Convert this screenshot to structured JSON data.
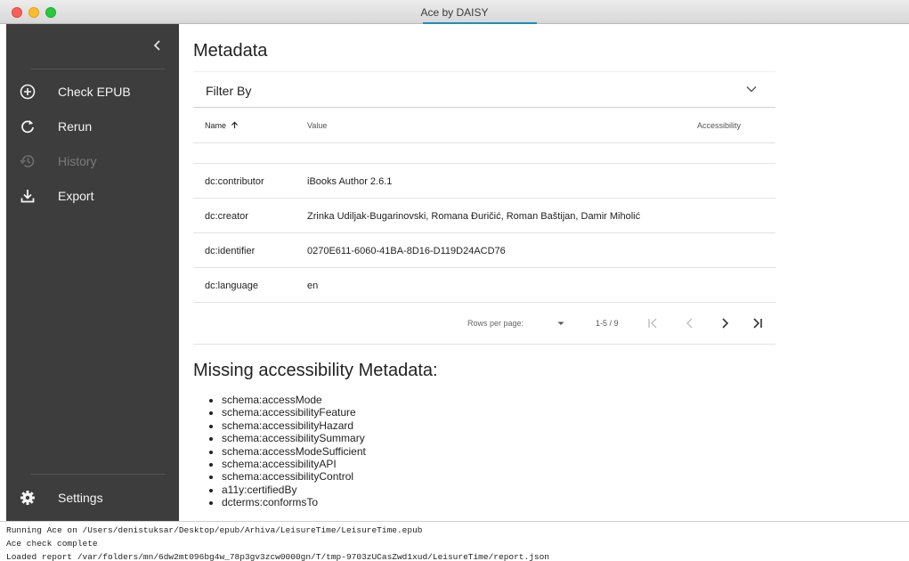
{
  "window": {
    "title": "Ace by DAISY"
  },
  "sidebar": {
    "items": [
      {
        "label": "Check EPUB",
        "icon": "add-circle-icon",
        "disabled": false
      },
      {
        "label": "Rerun",
        "icon": "refresh-icon",
        "disabled": false
      },
      {
        "label": "History",
        "icon": "history-icon",
        "disabled": true
      },
      {
        "label": "Export",
        "icon": "download-icon",
        "disabled": false
      }
    ],
    "settings_label": "Settings",
    "settings_icon": "gear-icon"
  },
  "main": {
    "title": "Metadata",
    "filter_label": "Filter By",
    "table": {
      "columns": [
        "Name",
        "Value",
        "Accessibility"
      ],
      "rows": [
        {
          "name": "",
          "value": ""
        },
        {
          "name": "dc:contributor",
          "value": "iBooks Author 2.6.1"
        },
        {
          "name": "dc:creator",
          "value": "Zrinka Udiljak-Bugarinovski, Romana Đuričić, Roman Baštijan, Damir Miholić"
        },
        {
          "name": "dc:identifier",
          "value": "0270E611-6060-41BA-8D16-D119D24ACD76"
        },
        {
          "name": "dc:language",
          "value": "en"
        }
      ]
    },
    "pagination": {
      "rows_per_page_label": "Rows per page:",
      "range": "1-5 / 9"
    },
    "missing_title": "Missing accessibility Metadata:",
    "missing_items": [
      "schema:accessMode",
      "schema:accessibilityFeature",
      "schema:accessibilityHazard",
      "schema:accessibilitySummary",
      "schema:accessModeSufficient",
      "schema:accessibilityAPI",
      "schema:accessibilityControl",
      "a11y:certifiedBy",
      "dcterms:conformsTo"
    ]
  },
  "console": {
    "lines": [
      "Running Ace on /Users/denistuksar/Desktop/epub/Arhiva/LeisureTime/LeisureTime.epub",
      "Ace check complete",
      "Loaded report /var/folders/mn/6dw2mt096bg4w_78p3gv3zcw0000gn/T/tmp-9703zUCasZwd1xud/LeisureTime/report.json"
    ]
  }
}
